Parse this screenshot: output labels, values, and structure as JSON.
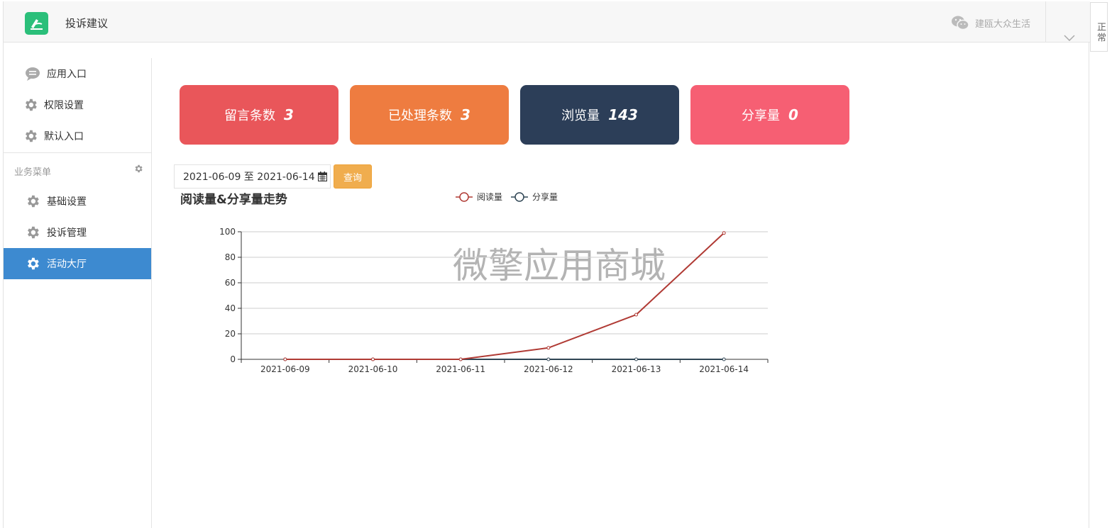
{
  "header": {
    "title": "投诉建议",
    "account_name": "建瓯大众生活"
  },
  "status_tab": {
    "label": "正常"
  },
  "sidebar": {
    "top_items": [
      {
        "label": "应用入口",
        "icon": "chat-bubble-icon"
      },
      {
        "label": "权限设置",
        "icon": "gear-icon"
      },
      {
        "label": "默认入口",
        "icon": "gear-icon"
      }
    ],
    "section_title": "业务菜单",
    "section_items": [
      {
        "label": "基础设置",
        "icon": "gear-icon"
      },
      {
        "label": "投诉管理",
        "icon": "gear-icon"
      },
      {
        "label": "活动大厅",
        "icon": "gear-icon",
        "active": true
      }
    ]
  },
  "stats": [
    {
      "label": "留言条数",
      "value": "3",
      "color": "#e9565a"
    },
    {
      "label": "已处理条数",
      "value": "3",
      "color": "#ee7c40"
    },
    {
      "label": "浏览量",
      "value": "143",
      "color": "#2c3e58"
    },
    {
      "label": "分享量",
      "value": "0",
      "color": "#f65f73"
    }
  ],
  "filter": {
    "date_range": "2021-06-09 至 2021-06-14",
    "query_label": "查询"
  },
  "watermark": "微擎应用商城",
  "chart_data": {
    "type": "line",
    "title": "阅读量&分享量走势",
    "categories": [
      "2021-06-09",
      "2021-06-10",
      "2021-06-11",
      "2021-06-12",
      "2021-06-13",
      "2021-06-14"
    ],
    "series": [
      {
        "name": "阅读量",
        "values": [
          0,
          0,
          0,
          9,
          35,
          99
        ],
        "color": "#b03a34"
      },
      {
        "name": "分享量",
        "values": [
          0,
          0,
          0,
          0,
          0,
          0
        ],
        "color": "#2f4554"
      }
    ],
    "ylim": [
      0,
      100
    ],
    "yticks": [
      0,
      20,
      40,
      60,
      80,
      100
    ],
    "grid": true,
    "legend_position": "top-center"
  }
}
